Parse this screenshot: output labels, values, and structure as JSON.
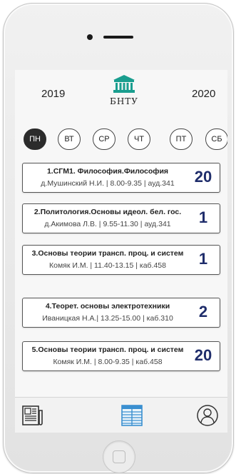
{
  "header": {
    "year_left": "2019",
    "year_right": "2020",
    "logo_text": "БНТУ"
  },
  "days": [
    {
      "label": "ПН",
      "active": true
    },
    {
      "label": "ВТ",
      "active": false
    },
    {
      "label": "СР",
      "active": false
    },
    {
      "label": "ЧТ",
      "active": false
    },
    {
      "label": "ПТ",
      "active": false
    },
    {
      "label": "СБ",
      "active": false
    }
  ],
  "lessons": [
    {
      "title": "1.СГМ1. Философия.Философия",
      "details": "д.Мушинский Н.И. | 8.00-9.35 | ауд.341",
      "number": "20"
    },
    {
      "title": "2.Политология.Основы идеол. бел. гос.",
      "details": "д.Акимова Л.В. | 9.55-11.30 | ауд.341",
      "number": "1"
    },
    {
      "title": "3.Основы теории трансп. проц. и систем",
      "details": "Комяк И.М. | 11.40-13.15 | каб.458",
      "number": "1"
    },
    {
      "title": "4.Теорет. основы электротехники",
      "details": "Иваницкая Н.А.| 13.25-15.00 | каб.310",
      "number": "2"
    },
    {
      "title": "5.Основы теории трансп. проц. и систем",
      "details": "Комяк И.М. | 8.00-9.35 | каб.458",
      "number": "20"
    }
  ],
  "navbar": {
    "items": [
      {
        "icon": "news-icon",
        "active": false
      },
      {
        "icon": "schedule-table-icon",
        "active": true
      },
      {
        "icon": "profile-icon",
        "active": false
      }
    ]
  },
  "colors": {
    "accent": "#1a9e8f",
    "number": "#1f2d6b",
    "active_nav": "#3a8fd0"
  }
}
